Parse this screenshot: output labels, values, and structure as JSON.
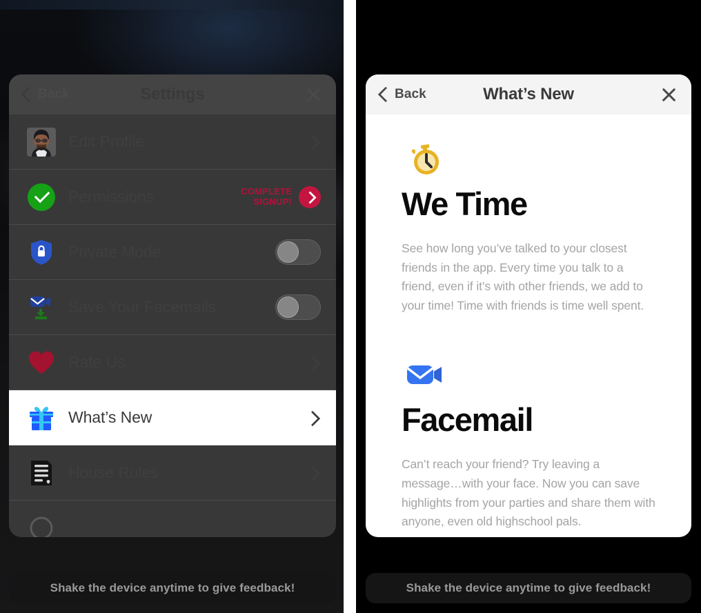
{
  "background": {
    "left_desc": "blurred dark app screen",
    "right_desc": "black"
  },
  "settings_panel": {
    "nav": {
      "back_label": "Back",
      "title": "Settings",
      "back_icon": "chevron-left-icon",
      "close_icon": "close-icon"
    },
    "rows": [
      {
        "id": "edit-profile",
        "label": "Edit Profile",
        "icon": "avatar-icon",
        "accessory": "chevron",
        "highlighted": false
      },
      {
        "id": "permissions",
        "label": "Permissions",
        "icon": "green-check-icon",
        "accessory": "badge",
        "badge_line1": "COMPLETE",
        "badge_line2": "SIGNUP!",
        "badge_color": "#b3123a",
        "badge_circle_color": "#c41540",
        "highlighted": false
      },
      {
        "id": "private-mode",
        "label": "Private Mode",
        "icon": "shield-lock-icon",
        "accessory": "toggle",
        "toggle_on": false,
        "highlighted": false
      },
      {
        "id": "save-your-facemails",
        "label": "Save Your Facemails",
        "icon": "facemail-download-icon",
        "accessory": "toggle",
        "toggle_on": false,
        "highlighted": false
      },
      {
        "id": "rate-us",
        "label": "Rate Us",
        "icon": "heart-icon",
        "accessory": "chevron",
        "highlighted": false
      },
      {
        "id": "whats-new",
        "label": "What’s New",
        "icon": "gift-icon",
        "accessory": "chevron",
        "highlighted": true
      },
      {
        "id": "house-rules",
        "label": "House Rules",
        "icon": "document-icon",
        "accessory": "chevron",
        "highlighted": false
      }
    ]
  },
  "whats_new_panel": {
    "nav": {
      "back_label": "Back",
      "title": "What’s New",
      "back_icon": "chevron-left-icon",
      "close_icon": "close-icon"
    },
    "sections": [
      {
        "id": "we-time",
        "icon": "stopwatch-icon",
        "title": "We Time",
        "text": "See how long you’ve talked to your closest friends in the app. Every time you talk to a friend, even if it’s with other friends, we add to your time! Time with friends is time well spent."
      },
      {
        "id": "facemail",
        "icon": "facemail-video-icon",
        "title": "Facemail",
        "text": "Can’t reach your friend? Try leaving a message…with your face. Now you can save highlights from your parties and share them with anyone, even old highschool pals."
      }
    ]
  },
  "toast": {
    "left_text": "Shake the device anytime to give feedback!",
    "right_text": "Shake the device anytime to give feedback!"
  },
  "colors": {
    "panel_left_bg": "#3a3a3a",
    "panel_right_bg": "#ffffff",
    "navbar_right_bg": "#f4f4f4",
    "accent_red": "#c41540",
    "accent_green": "#16a117",
    "accent_blue": "#2f6bf2",
    "accent_yellow": "#e8b323",
    "heart_red": "#a3122f",
    "toast_bg": "#151515",
    "toast_text": "#9a9a9a"
  }
}
